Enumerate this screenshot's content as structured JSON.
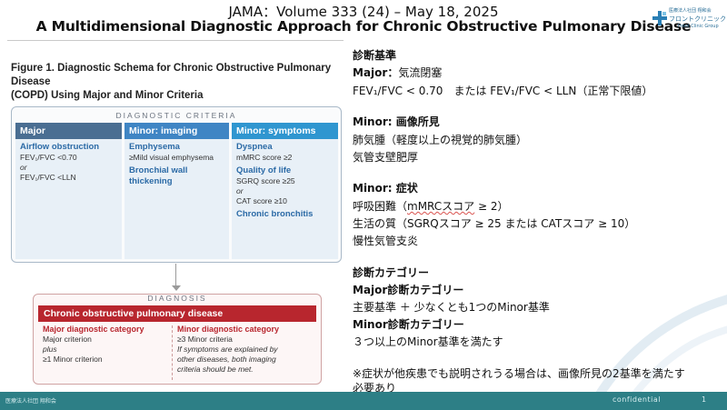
{
  "header": {
    "journal_line": "JAMA：Volume 333 (24) – May 18, 2025",
    "title": "A Multidimensional Diagnostic Approach for Chronic Obstructive Pulmonary Disease"
  },
  "logo": {
    "line1": "医療法人社団 翔和会",
    "line2": "フロントクリニック グループ",
    "line3": "Front Clinic Group"
  },
  "figure": {
    "title_bold": "Figure 1. Diagnostic Schema for Chronic Obstructive Pulmonary Disease",
    "title_rest": "(COPD) Using Major and Minor Criteria",
    "criteria_label": "DIAGNOSTIC CRITERIA",
    "major": {
      "head": "Major",
      "sub": "Airflow obstruction",
      "l1": "FEV₁/FVC <0.70",
      "or": "or",
      "l2": "FEV₁/FVC <LLN"
    },
    "imaging": {
      "head": "Minor: imaging",
      "h1": "Emphysema",
      "l1": "≥Mild visual emphysema",
      "h2a": "Bronchial wall",
      "h2b": "thickening"
    },
    "symptoms": {
      "head": "Minor: symptoms",
      "h1": "Dyspnea",
      "l1": "mMRC score ≥2",
      "h2": "Quality of life",
      "l2": "SGRQ  score ≥25",
      "or": "or",
      "l3": "CAT score ≥10",
      "h3": "Chronic bronchitis"
    },
    "diagnosis_label": "DIAGNOSIS",
    "diagnosis_head": "Chronic obstructive pulmonary disease",
    "major_cat": {
      "head": "Major diagnostic category",
      "l1": "Major criterion",
      "plus": "plus",
      "l2": "≥1 Minor criterion"
    },
    "minor_cat": {
      "head": "Minor diagnostic category",
      "l1": "≥3 Minor criteria",
      "note1": "If symptoms are explained by",
      "note2": "other diseases, both imaging",
      "note3": "criteria should be met."
    }
  },
  "panel": {
    "criteria_title": "診断基準",
    "major_label": "Major：",
    "major_text": "気流閉塞",
    "major_def_a": "FEV₁/FVC < 0.70　または FEV₁/FVC < LLN（正常下限値）",
    "imaging_title": "Minor: 画像所見",
    "imaging_1": "肺気腫（軽度以上の視覚的肺気腫）",
    "imaging_2": "気管支壁肥厚",
    "symptom_title": "Minor: 症状",
    "symptom_1a": "呼吸困難（",
    "symptom_1b": "mMRCスコア",
    "symptom_1c": " ≥ 2）",
    "symptom_2": "生活の質（SGRQスコア ≥ 25 または CATスコア ≥ 10）",
    "symptom_3": "慢性気管支炎",
    "category_title": "診断カテゴリー",
    "major_cat_title": "Major診断カテゴリー",
    "major_cat_text": "主要基準 ＋ 少なくとも1つのMinor基準",
    "minor_cat_title": "Minor診断カテゴリー",
    "minor_cat_text": "３つ以上のMinor基準を満たす",
    "note_1": "※症状が他疾患でも説明されうる場合は、画像所見の2基準を満たす",
    "note_2": "必要あり"
  },
  "footer": {
    "left": "医療法人社団 翔和会",
    "right": "confidential",
    "page": "1"
  }
}
